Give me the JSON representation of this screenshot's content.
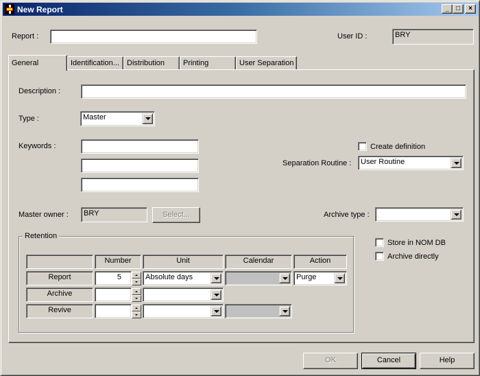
{
  "window": {
    "title": "New Report",
    "controls": {
      "minimize": "_",
      "maximize": "□",
      "close": "×"
    }
  },
  "header": {
    "report_label": "Report :",
    "report_value": "",
    "user_id_label": "User ID :",
    "user_id_value": "BRY"
  },
  "tabs": [
    {
      "label": "General",
      "active": true
    },
    {
      "label": "Identification...",
      "active": false
    },
    {
      "label": "Distribution",
      "active": false
    },
    {
      "label": "Printing",
      "active": false
    },
    {
      "label": "User Separation",
      "active": false
    }
  ],
  "general": {
    "description_label": "Description :",
    "description_value": "",
    "type_label": "Type :",
    "type_value": "Master",
    "keywords_label": "Keywords :",
    "keywords": [
      "",
      "",
      ""
    ],
    "create_definition_label": "Create definition",
    "create_definition_checked": false,
    "separation_routine_label": "Separation Routine :",
    "separation_routine_value": "User Routine",
    "master_owner_label": "Master owner :",
    "master_owner_value": "BRY",
    "select_button": "Select...",
    "archive_type_label": "Archive type :",
    "archive_type_value": "",
    "store_in_nom_db_label": "Store in NOM DB",
    "store_in_nom_db_checked": false,
    "archive_directly_label": "Archive directly",
    "archive_directly_checked": false
  },
  "retention": {
    "title": "Retention",
    "columns": [
      "",
      "Number",
      "Unit",
      "Calendar",
      "Action"
    ],
    "rows": [
      {
        "label": "Report",
        "number": "5",
        "unit": "Absolute days",
        "calendar": "",
        "action": "Purge"
      },
      {
        "label": "Archive",
        "number": "",
        "unit": ""
      },
      {
        "label": "Revive",
        "number": "",
        "unit": "",
        "calendar": ""
      }
    ]
  },
  "buttons": {
    "ok": "OK",
    "cancel": "Cancel",
    "help": "Help"
  }
}
